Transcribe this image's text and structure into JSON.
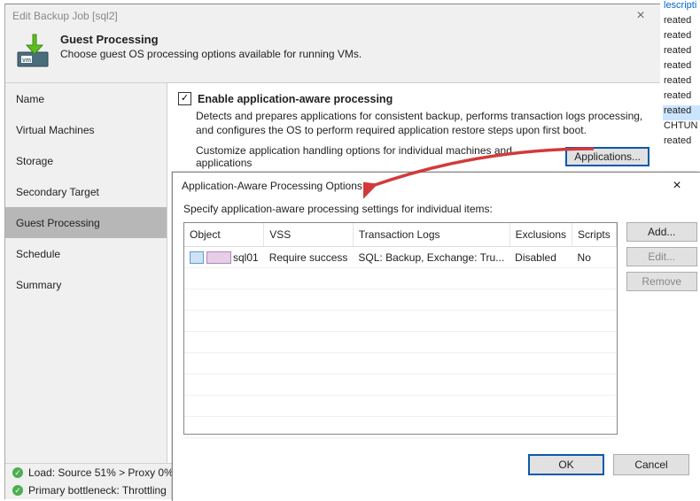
{
  "dialog": {
    "title": "Edit Backup Job [sql2]",
    "header": {
      "title": "Guest Processing",
      "subtitle": "Choose guest OS processing options available for running VMs."
    },
    "nav": [
      "Name",
      "Virtual Machines",
      "Storage",
      "Secondary Target",
      "Guest Processing",
      "Schedule",
      "Summary"
    ],
    "content": {
      "enable_label": "Enable application-aware processing",
      "enable_desc": "Detects and prepares applications for consistent backup, performs transaction logs processing, and configures the OS to perform required application restore steps upon first boot.",
      "customize_text": "Customize application handling options for individual machines and applications",
      "applications_btn": "Applications..."
    },
    "status": {
      "line1": "Load: Source 51% > Proxy 0% >",
      "line2": "Primary bottleneck: Throttling"
    }
  },
  "subdialog": {
    "title": "Application-Aware Processing Options",
    "desc": "Specify application-aware processing settings for individual items:",
    "columns": [
      "Object",
      "VSS",
      "Transaction Logs",
      "Exclusions",
      "Scripts"
    ],
    "rows": [
      {
        "object": "sql01",
        "vss": "Require success",
        "tlogs": "SQL: Backup, Exchange: Tru...",
        "excl": "Disabled",
        "scripts": "No"
      }
    ],
    "buttons": {
      "add": "Add...",
      "edit": "Edit...",
      "remove": "Remove"
    },
    "footer": {
      "ok": "OK",
      "cancel": "Cancel"
    }
  },
  "side": {
    "link": "lescripti",
    "items": [
      "reated",
      "reated",
      "reated",
      "reated",
      "reated",
      "reated",
      "reated",
      "CHTUN",
      "reated"
    ],
    "selected_index": 6
  }
}
